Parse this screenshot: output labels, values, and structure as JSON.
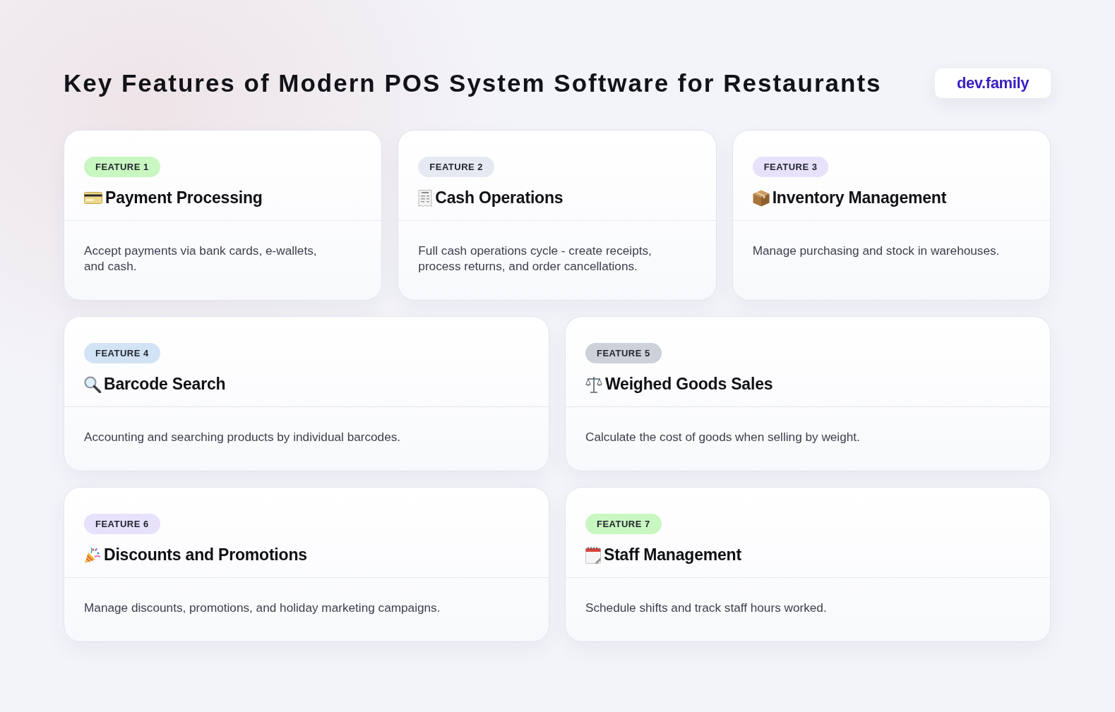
{
  "title": "Key Features of Modern POS System Software for Restaurants",
  "logo": {
    "text": "dev.family"
  },
  "rows": [
    {
      "cards": [
        {
          "badge": "FEATURE 1",
          "color": "#c9f7c1",
          "title": "Payment Processing",
          "description": "Accept payments via bank cards, e-wallets, and cash."
        },
        {
          "badge": "FEATURE 2",
          "color": "#e6e9f1",
          "title": "Cash Operations",
          "description": "Full cash operations cycle - create receipts, process returns, and order cancellations."
        },
        {
          "badge": "FEATURE 3",
          "color": "#e7e1fb",
          "title": "Inventory Management",
          "description": "Manage purchasing and stock in warehouses."
        }
      ]
    },
    {
      "cards": [
        {
          "badge": "FEATURE 4",
          "color": "#d2e3f5",
          "title": "Barcode Search",
          "description": "Accounting and searching products by individual barcodes."
        },
        {
          "badge": "FEATURE 5",
          "color": "#cdd1da",
          "title": "Weighed Goods Sales",
          "description": "Calculate the cost of goods when selling by weight."
        }
      ]
    },
    {
      "cards": [
        {
          "badge": "FEATURE 6",
          "color": "#e7e1fb",
          "title": "Discounts and Promotions",
          "description": "Manage discounts, promotions, and holiday marketing campaigns."
        },
        {
          "badge": "FEATURE 7",
          "color": "#c9f7c1",
          "title": "Staff Management",
          "description": "Schedule shifts and track staff hours worked."
        }
      ]
    }
  ]
}
